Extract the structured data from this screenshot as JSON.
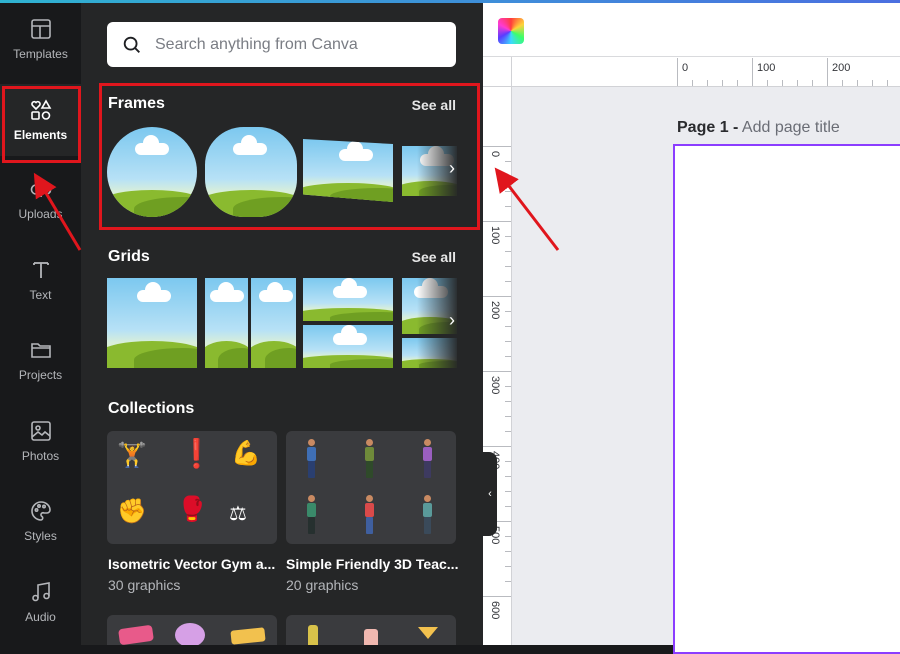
{
  "rail": {
    "items": [
      {
        "label": "Templates",
        "icon": "templates-icon"
      },
      {
        "label": "Elements",
        "icon": "elements-icon",
        "active": true
      },
      {
        "label": "Uploads",
        "icon": "upload-icon"
      },
      {
        "label": "Text",
        "icon": "text-icon"
      },
      {
        "label": "Projects",
        "icon": "folder-icon"
      },
      {
        "label": "Photos",
        "icon": "photo-icon"
      },
      {
        "label": "Styles",
        "icon": "palette-icon"
      },
      {
        "label": "Audio",
        "icon": "music-icon"
      }
    ]
  },
  "search": {
    "placeholder": "Search anything from Canva"
  },
  "frames": {
    "title": "Frames",
    "see_all": "See all"
  },
  "grids": {
    "title": "Grids",
    "see_all": "See all"
  },
  "collections": {
    "title": "Collections",
    "items": [
      {
        "title": "Isometric Vector Gym a...",
        "count": "30 graphics"
      },
      {
        "title": "Simple Friendly 3D Teac...",
        "count": "20 graphics"
      }
    ]
  },
  "editor": {
    "page_number": "Page 1 -",
    "page_title_placeholder": "Add page title",
    "ruler_h": [
      "0",
      "100",
      "200"
    ],
    "ruler_v": [
      "0",
      "100",
      "200",
      "300",
      "400",
      "500",
      "600"
    ]
  },
  "colors": {
    "accent": "#8b3dff",
    "highlight": "#e0161d",
    "panel": "#252627",
    "rail": "#18191b"
  }
}
